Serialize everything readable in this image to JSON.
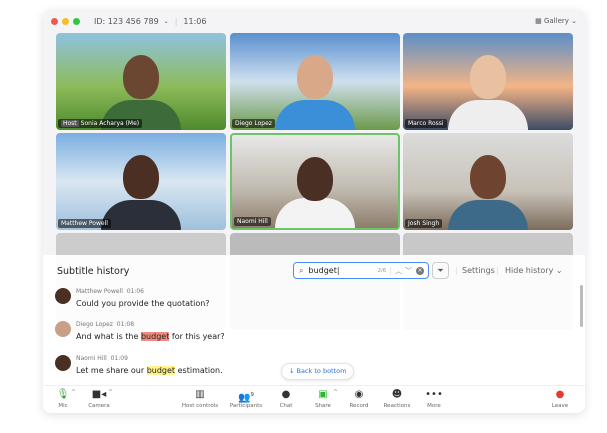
{
  "titlebar": {
    "meeting_id": "ID: 123 456 789",
    "time": "11:06",
    "view": "Gallery"
  },
  "tiles": [
    {
      "name": "Sonia Acharya (Me)",
      "host_badge": "Host"
    },
    {
      "name": "Diego Lopez"
    },
    {
      "name": "Marco Rossi"
    },
    {
      "name": "Matthew Powell"
    },
    {
      "name": "Naomi Hill"
    },
    {
      "name": "Josh Singh"
    }
  ],
  "subtitle_panel": {
    "title": "Subtitle history",
    "search_value": "budget",
    "match_count": "2/6",
    "settings": "Settings",
    "hide_history": "Hide history",
    "back_to_bottom": "Back to bottom",
    "messages": [
      {
        "speaker": "Matthew Powell",
        "time": "01:06",
        "before": "Could you provide the quotation?",
        "match": "",
        "after": ""
      },
      {
        "speaker": "Diego Lopez",
        "time": "01:08",
        "before": "And what is the ",
        "match": "budget",
        "after": " for this year?"
      },
      {
        "speaker": "Naomi Hill",
        "time": "01:09",
        "before": "Let me share our ",
        "match": "budget",
        "after": " estimation."
      }
    ]
  },
  "toolbar": {
    "mic": "Mic",
    "camera": "Camera",
    "host_controls": "Host controls",
    "participants": "Participants",
    "participants_count": "9",
    "chat": "Chat",
    "share": "Share",
    "record": "Record",
    "reactions": "Reactions",
    "more": "More",
    "leave": "Leave"
  }
}
